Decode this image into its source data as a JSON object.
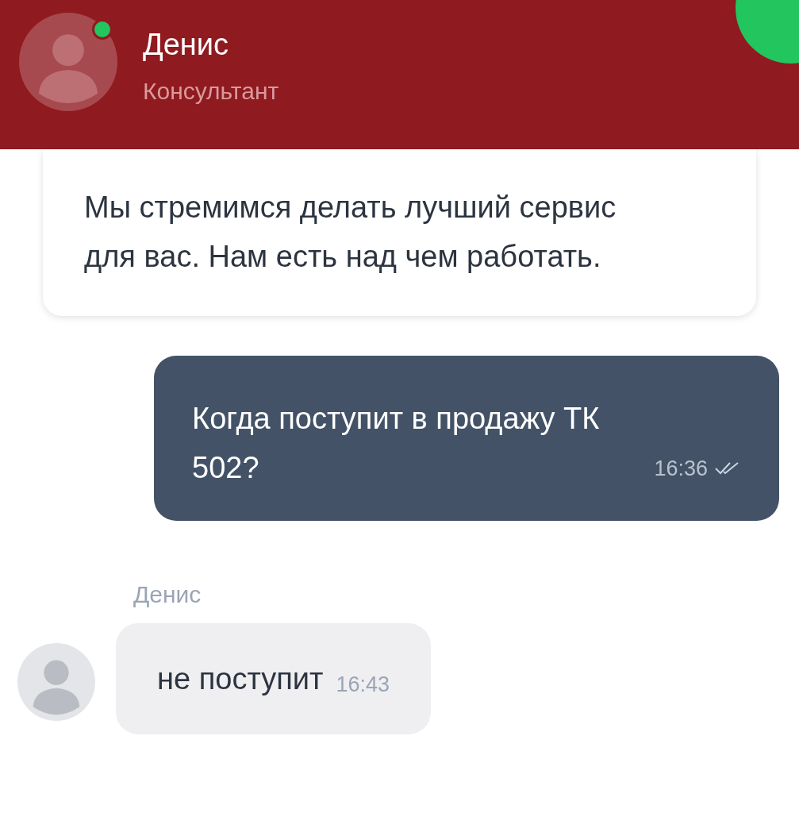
{
  "header": {
    "name": "Денис",
    "role": "Консультант",
    "online": true
  },
  "messages": [
    {
      "kind": "card",
      "text": "Мы стремимся делать лучший сервис для вас. Нам есть над чем работать."
    },
    {
      "kind": "outgoing",
      "text": "Когда поступит в продажу ТК 502?",
      "time": "16:36",
      "read": true
    },
    {
      "kind": "incoming",
      "sender": "Денис",
      "text": "не поступит",
      "time": "16:43"
    }
  ]
}
